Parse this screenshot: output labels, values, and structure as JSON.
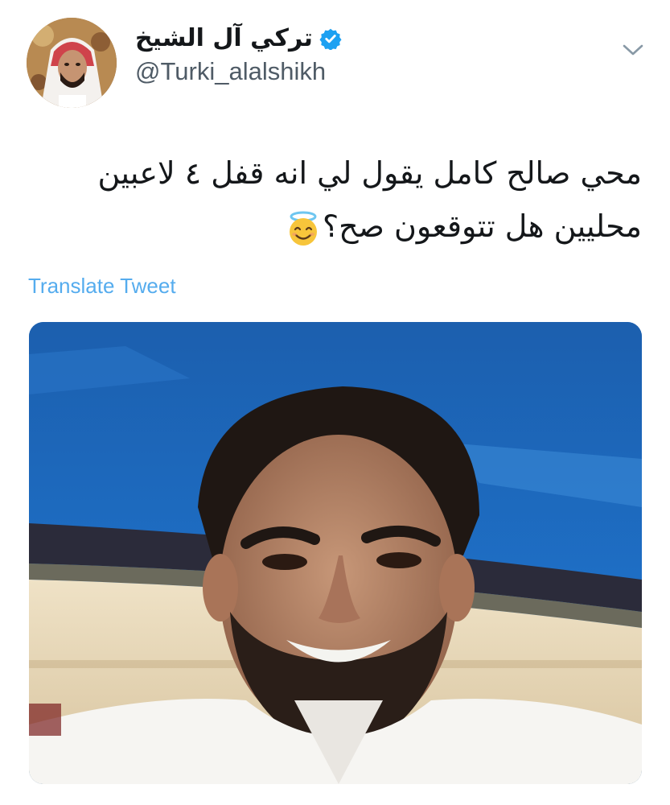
{
  "tweet": {
    "author": {
      "display_name": "تركي آل الشيخ",
      "handle": "@Turki_alalshikh",
      "verified": true,
      "avatar_icon": "profile-photo"
    },
    "menu_icon": "chevron-down-icon",
    "text_lines": [
      "محي صالح كامل يقول لي انه قفل ٤ لاعبين",
      "محليين هل تتوقعون صح؟"
    ],
    "emoji": "smiling-face-with-halo",
    "translate_label": "Translate Tweet",
    "media": {
      "kind": "photo",
      "description_icon": "selfie-photo"
    }
  },
  "colors": {
    "text": "#14171a",
    "handle": "#4f5b66",
    "link": "#55acee",
    "verified": "#1da1f2",
    "chevron": "#8899a6"
  }
}
